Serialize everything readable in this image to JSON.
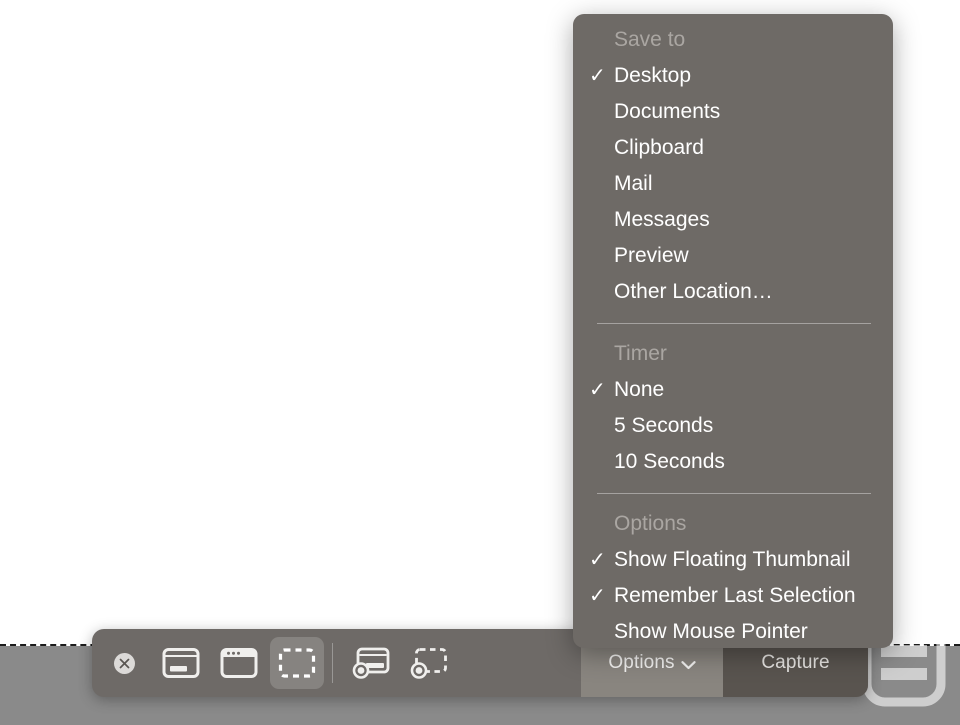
{
  "screen": {
    "selection_edge": "dashed-selection-boundary",
    "outside_fill": "#8a8a8a",
    "inside_fill": "#ffffff"
  },
  "watermark": {
    "name": "engadget-logo",
    "letter": "e"
  },
  "toolbar": {
    "close_label": "✕",
    "tools": [
      {
        "id": "capture-entire-screen",
        "label": "Capture Entire Screen",
        "icon": "screen-icon",
        "selected": false
      },
      {
        "id": "capture-selected-window",
        "label": "Capture Selected Window",
        "icon": "window-icon",
        "selected": false
      },
      {
        "id": "capture-selected-portion",
        "label": "Capture Selected Portion",
        "icon": "selection-icon",
        "selected": true
      },
      {
        "id": "record-entire-screen",
        "label": "Record Entire Screen",
        "icon": "record-screen-icon",
        "selected": false
      },
      {
        "id": "record-selected-portion",
        "label": "Record Selected Portion",
        "icon": "record-selection-icon",
        "selected": false
      }
    ],
    "options_label": "Options",
    "options_chevron": "chevron-down-icon",
    "capture_label": "Capture",
    "background": "#6e6a67",
    "options_background": "#89857f",
    "capture_background": "#59544f"
  },
  "options_menu": {
    "background": "#6e6a66",
    "sections": [
      {
        "title": "Save to",
        "items": [
          {
            "label": "Desktop",
            "checked": true
          },
          {
            "label": "Documents",
            "checked": false
          },
          {
            "label": "Clipboard",
            "checked": false
          },
          {
            "label": "Mail",
            "checked": false
          },
          {
            "label": "Messages",
            "checked": false
          },
          {
            "label": "Preview",
            "checked": false
          },
          {
            "label": "Other Location…",
            "checked": false
          }
        ]
      },
      {
        "title": "Timer",
        "items": [
          {
            "label": "None",
            "checked": true
          },
          {
            "label": "5 Seconds",
            "checked": false
          },
          {
            "label": "10 Seconds",
            "checked": false
          }
        ]
      },
      {
        "title": "Options",
        "items": [
          {
            "label": "Show Floating Thumbnail",
            "checked": true
          },
          {
            "label": "Remember Last Selection",
            "checked": true
          },
          {
            "label": "Show Mouse Pointer",
            "checked": false
          }
        ]
      }
    ],
    "check_glyph": "✓"
  }
}
